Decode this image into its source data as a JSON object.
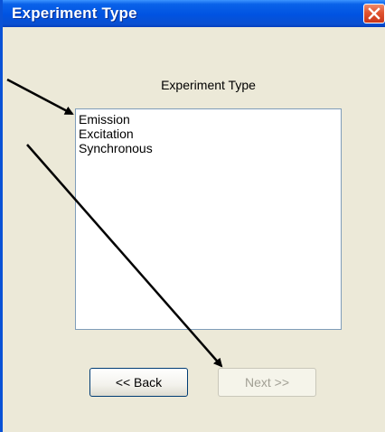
{
  "window": {
    "title": "Experiment Type",
    "close_icon": "close-icon"
  },
  "group": {
    "label": "Experiment Type"
  },
  "list": {
    "items": [
      "Emission",
      "Excitation",
      "Synchronous"
    ]
  },
  "buttons": {
    "back_label": "<< Back",
    "next_label": "Next >>",
    "next_enabled": false
  },
  "annotations": {
    "arrow_count": 2,
    "arrow_color": "#000000"
  },
  "colors": {
    "titlebar": "#0053e1",
    "dialog_bg": "#ece9d8",
    "close_button": "#e0532f",
    "disabled_text": "#a19f94"
  }
}
